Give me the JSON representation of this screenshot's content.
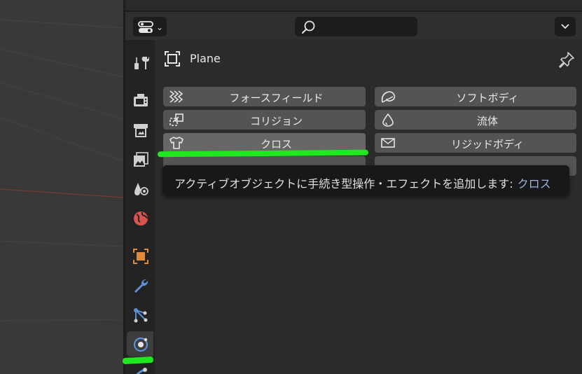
{
  "header": {
    "editor_type_icon": "properties-editor-icon",
    "chevron": "⌄",
    "search_placeholder": ""
  },
  "tabs": [
    {
      "name": "tool",
      "icon": "tool-settings-icon"
    },
    {
      "name": "render",
      "icon": "render-icon"
    },
    {
      "name": "output",
      "icon": "output-icon"
    },
    {
      "name": "view-layer",
      "icon": "view-layer-icon"
    },
    {
      "name": "scene",
      "icon": "scene-icon"
    },
    {
      "name": "world",
      "icon": "world-icon"
    },
    {
      "name": "object",
      "icon": "object-icon"
    },
    {
      "name": "modifiers",
      "icon": "wrench-icon"
    },
    {
      "name": "particles",
      "icon": "particles-icon"
    },
    {
      "name": "physics",
      "icon": "physics-icon",
      "active": true
    },
    {
      "name": "constraints",
      "icon": "constraints-icon"
    }
  ],
  "object": {
    "name": "Plane"
  },
  "physics_buttons": [
    {
      "label": "フォースフィールド",
      "icon": "force-field-icon"
    },
    {
      "label": "ソフトボディ",
      "icon": "soft-body-icon"
    },
    {
      "label": "コリジョン",
      "icon": "collision-icon"
    },
    {
      "label": "流体",
      "icon": "fluid-icon"
    },
    {
      "label": "クロス",
      "icon": "cloth-icon",
      "hovered": true
    },
    {
      "label": "リジッドボディ",
      "icon": "rigid-body-icon"
    }
  ],
  "tooltip": {
    "text": "アクティブオブジェクトに手続き型操作・エフェクトを追加します:",
    "accent": "クロス"
  },
  "colors": {
    "accent_highlight": "#1fe81f",
    "object_orange": "#e08a3c",
    "tab_blue": "#5b8fd6",
    "world_red": "#d9534f",
    "tooltip_accent": "#9ab4e0"
  }
}
